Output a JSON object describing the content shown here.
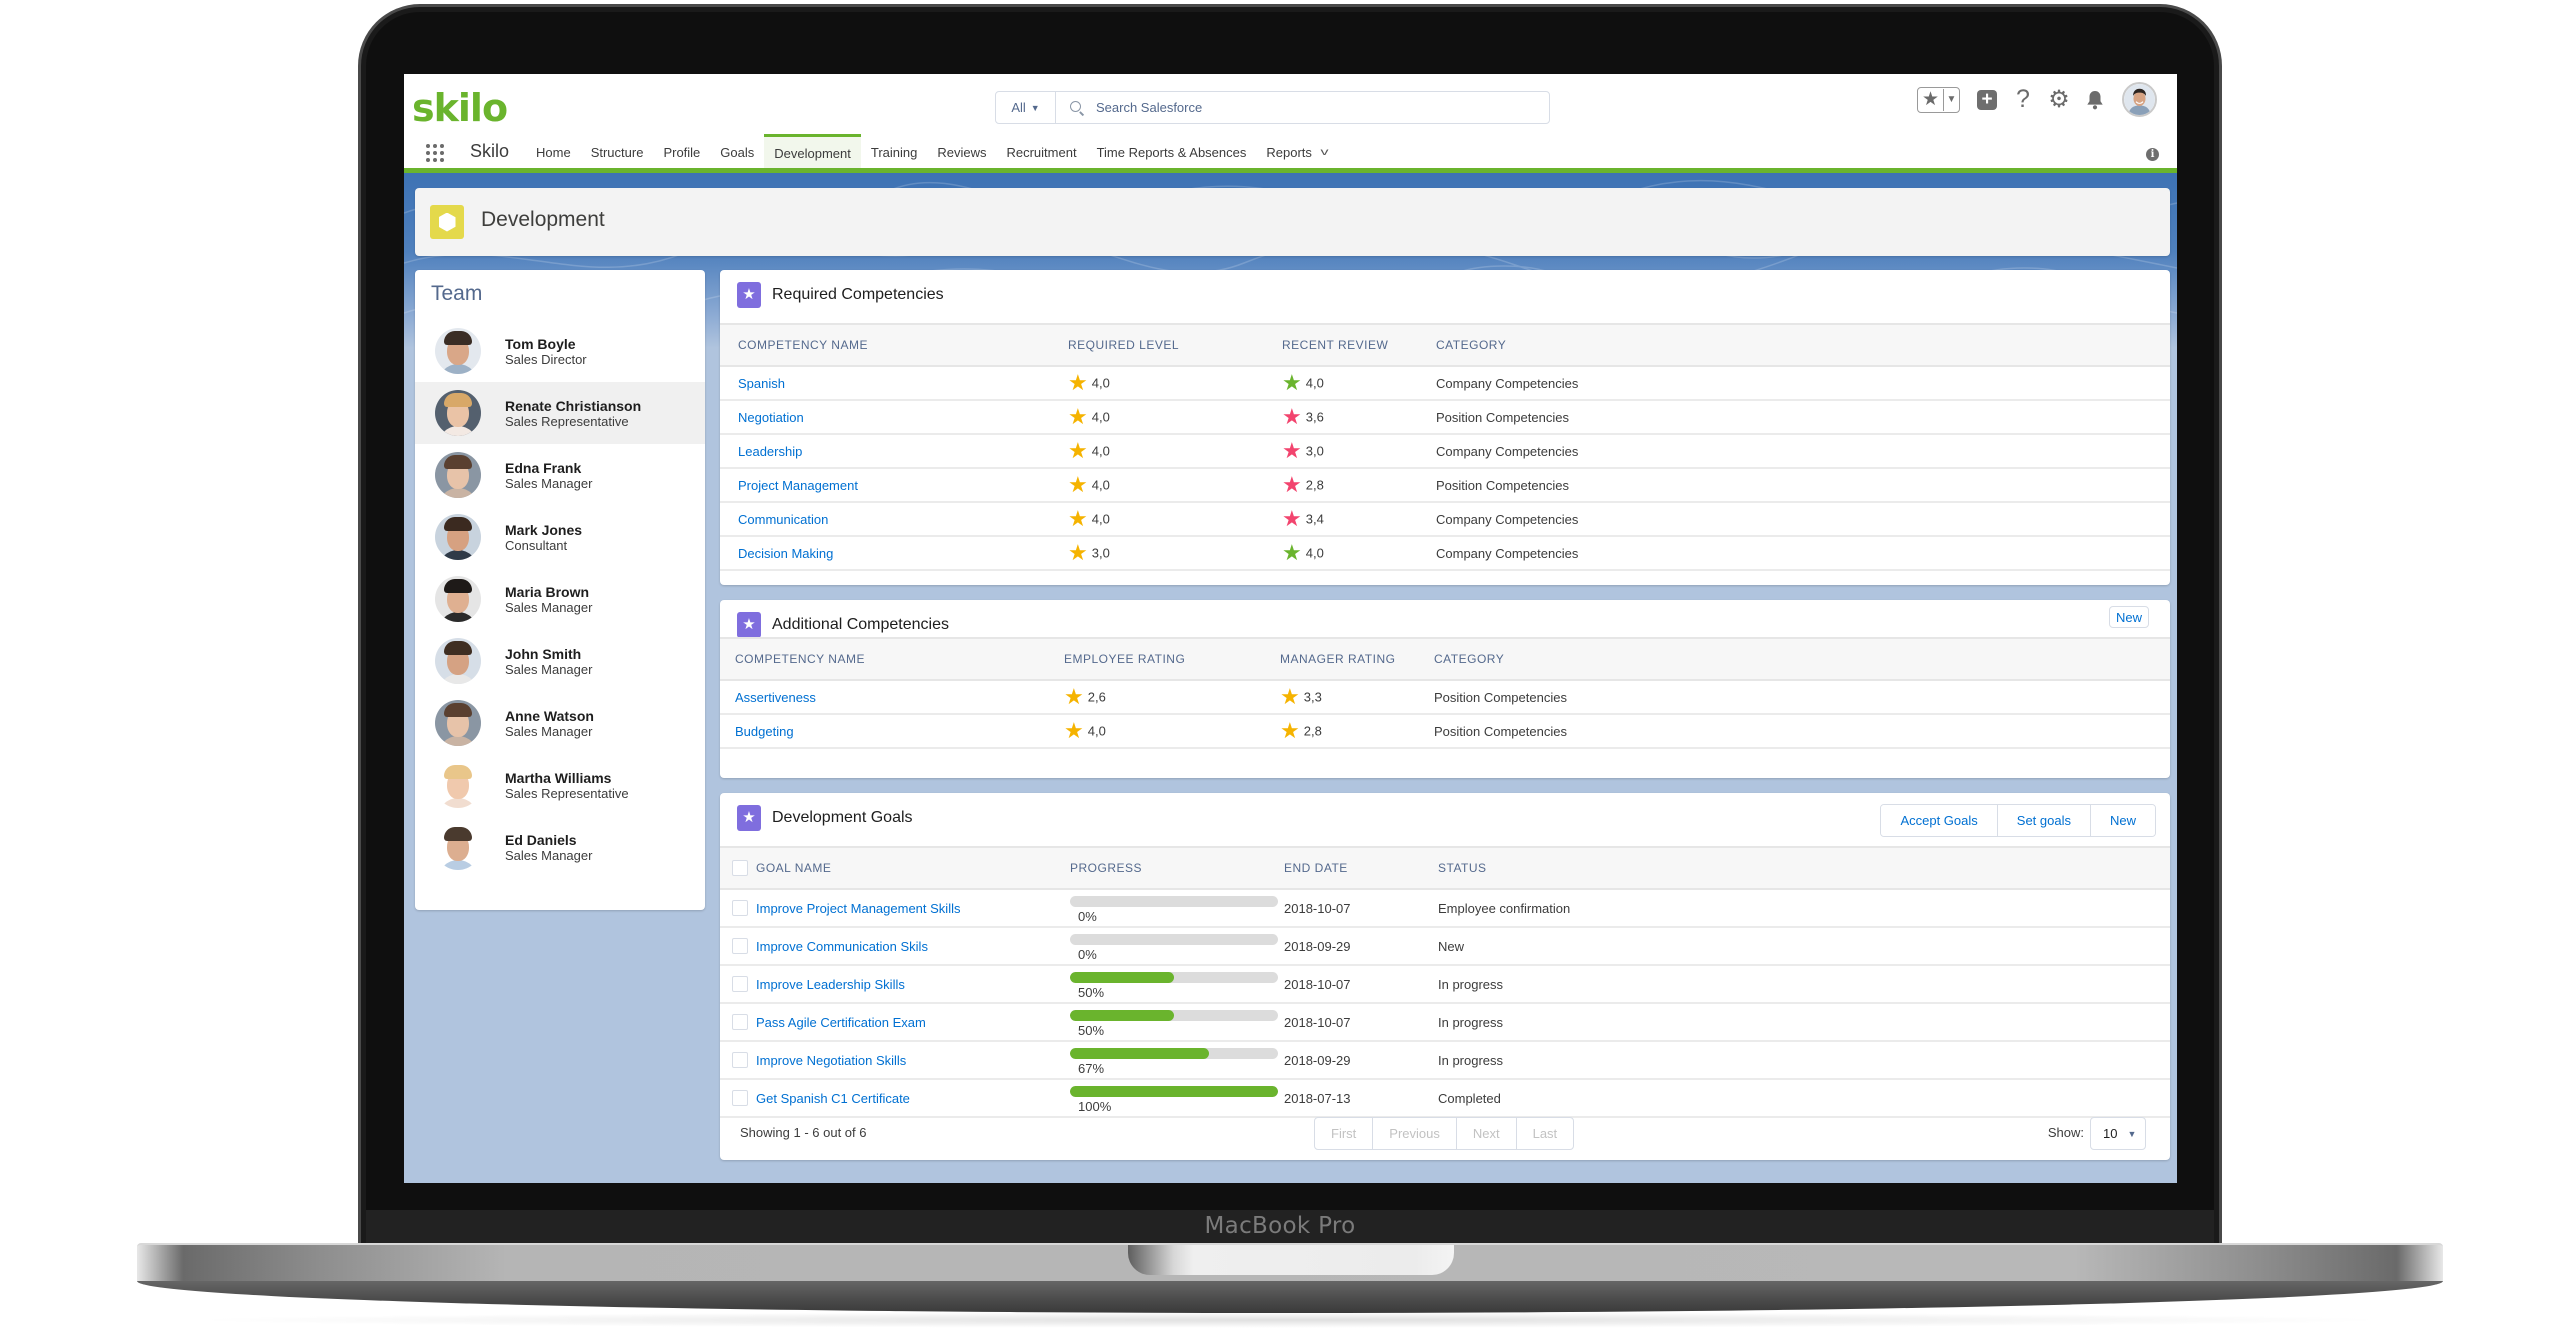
{
  "device": {
    "label": "MacBook Pro"
  },
  "header": {
    "logo": "skilo",
    "search": {
      "scope": "All",
      "placeholder": "Search Salesforce"
    },
    "icons": [
      "favorites-star-icon",
      "add-icon",
      "help-icon",
      "setup-gear-icon",
      "notifications-bell-icon",
      "user-avatar"
    ]
  },
  "nav": {
    "app_name": "Skilo",
    "items": [
      {
        "label": "Home"
      },
      {
        "label": "Structure"
      },
      {
        "label": "Profile"
      },
      {
        "label": "Goals"
      },
      {
        "label": "Development",
        "active": true
      },
      {
        "label": "Training"
      },
      {
        "label": "Reviews"
      },
      {
        "label": "Recruitment"
      },
      {
        "label": "Time Reports & Absences"
      },
      {
        "label": "Reports",
        "dropdown": true
      }
    ],
    "info_icon": "i"
  },
  "page": {
    "title": "Development",
    "icon_color": "#e4d94b"
  },
  "team": {
    "title": "Team",
    "members": [
      {
        "name": "Tom Boyle",
        "role": "Sales Director",
        "selected": false
      },
      {
        "name": "Renate Christianson",
        "role": "Sales Representative",
        "selected": true
      },
      {
        "name": "Edna Frank",
        "role": "Sales Manager",
        "selected": false
      },
      {
        "name": "Mark Jones",
        "role": "Consultant",
        "selected": false
      },
      {
        "name": "Maria Brown",
        "role": "Sales Manager",
        "selected": false
      },
      {
        "name": "John Smith",
        "role": "Sales Manager",
        "selected": false
      },
      {
        "name": "Anne Watson",
        "role": "Sales Manager",
        "selected": false
      },
      {
        "name": "Martha Williams",
        "role": "Sales Representative",
        "selected": false
      },
      {
        "name": "Ed Daniels",
        "role": "Sales Manager",
        "selected": false
      }
    ]
  },
  "colors": {
    "accent_green": "#6ab42d",
    "link_blue": "#0070d2",
    "star_gold": "#f5b300",
    "star_green": "#6ab42d",
    "star_red": "#f2446e",
    "card_icon_purple": "#7f6ede"
  },
  "required": {
    "title": "Required Competencies",
    "columns": [
      "COMPETENCY NAME",
      "REQUIRED LEVEL",
      "RECENT REVIEW",
      "CATEGORY"
    ],
    "rows": [
      {
        "name": "Spanish",
        "required": "4,0",
        "review": "4,0",
        "review_status": "met",
        "category": "Company Competencies"
      },
      {
        "name": "Negotiation",
        "required": "4,0",
        "review": "3,6",
        "review_status": "below",
        "category": "Position Competencies"
      },
      {
        "name": "Leadership",
        "required": "4,0",
        "review": "3,0",
        "review_status": "below",
        "category": "Company Competencies"
      },
      {
        "name": "Project Management",
        "required": "4,0",
        "review": "2,8",
        "review_status": "below",
        "category": "Position Competencies"
      },
      {
        "name": "Communication",
        "required": "4,0",
        "review": "3,4",
        "review_status": "below",
        "category": "Company Competencies"
      },
      {
        "name": "Decision Making",
        "required": "3,0",
        "review": "4,0",
        "review_status": "met",
        "category": "Company Competencies"
      }
    ]
  },
  "additional": {
    "title": "Additional Competencies",
    "new_label": "New",
    "columns": [
      "COMPETENCY NAME",
      "EMPLOYEE RATING",
      "MANAGER RATING",
      "CATEGORY"
    ],
    "rows": [
      {
        "name": "Assertiveness",
        "employee": "2,6",
        "manager": "3,3",
        "category": "Position Competencies"
      },
      {
        "name": "Budgeting",
        "employee": "4,0",
        "manager": "2,8",
        "category": "Position Competencies"
      }
    ]
  },
  "goals": {
    "title": "Development Goals",
    "actions": [
      "Accept Goals",
      "Set goals",
      "New"
    ],
    "columns": [
      "GOAL NAME",
      "PROGRESS",
      "END DATE",
      "STATUS"
    ],
    "rows": [
      {
        "name": "Improve Project Management Skills",
        "progress": 0,
        "progress_label": "0%",
        "end_date": "2018-10-07",
        "status": "Employee confirmation"
      },
      {
        "name": "Improve Communication Skils",
        "progress": 0,
        "progress_label": "0%",
        "end_date": "2018-09-29",
        "status": "New"
      },
      {
        "name": "Improve Leadership Skills",
        "progress": 50,
        "progress_label": "50%",
        "end_date": "2018-10-07",
        "status": "In progress"
      },
      {
        "name": "Pass Agile Certification Exam",
        "progress": 50,
        "progress_label": "50%",
        "end_date": "2018-10-07",
        "status": "In progress"
      },
      {
        "name": "Improve Negotiation Skills",
        "progress": 67,
        "progress_label": "67%",
        "end_date": "2018-09-29",
        "status": "In progress"
      },
      {
        "name": "Get Spanish C1 Certificate",
        "progress": 100,
        "progress_label": "100%",
        "end_date": "2018-07-13",
        "status": "Completed"
      }
    ],
    "footer": {
      "showing": "Showing 1 - 6 out of  6",
      "pager": [
        "First",
        "Previous",
        "Next",
        "Last"
      ],
      "show_label": "Show:",
      "page_size": "10"
    }
  }
}
